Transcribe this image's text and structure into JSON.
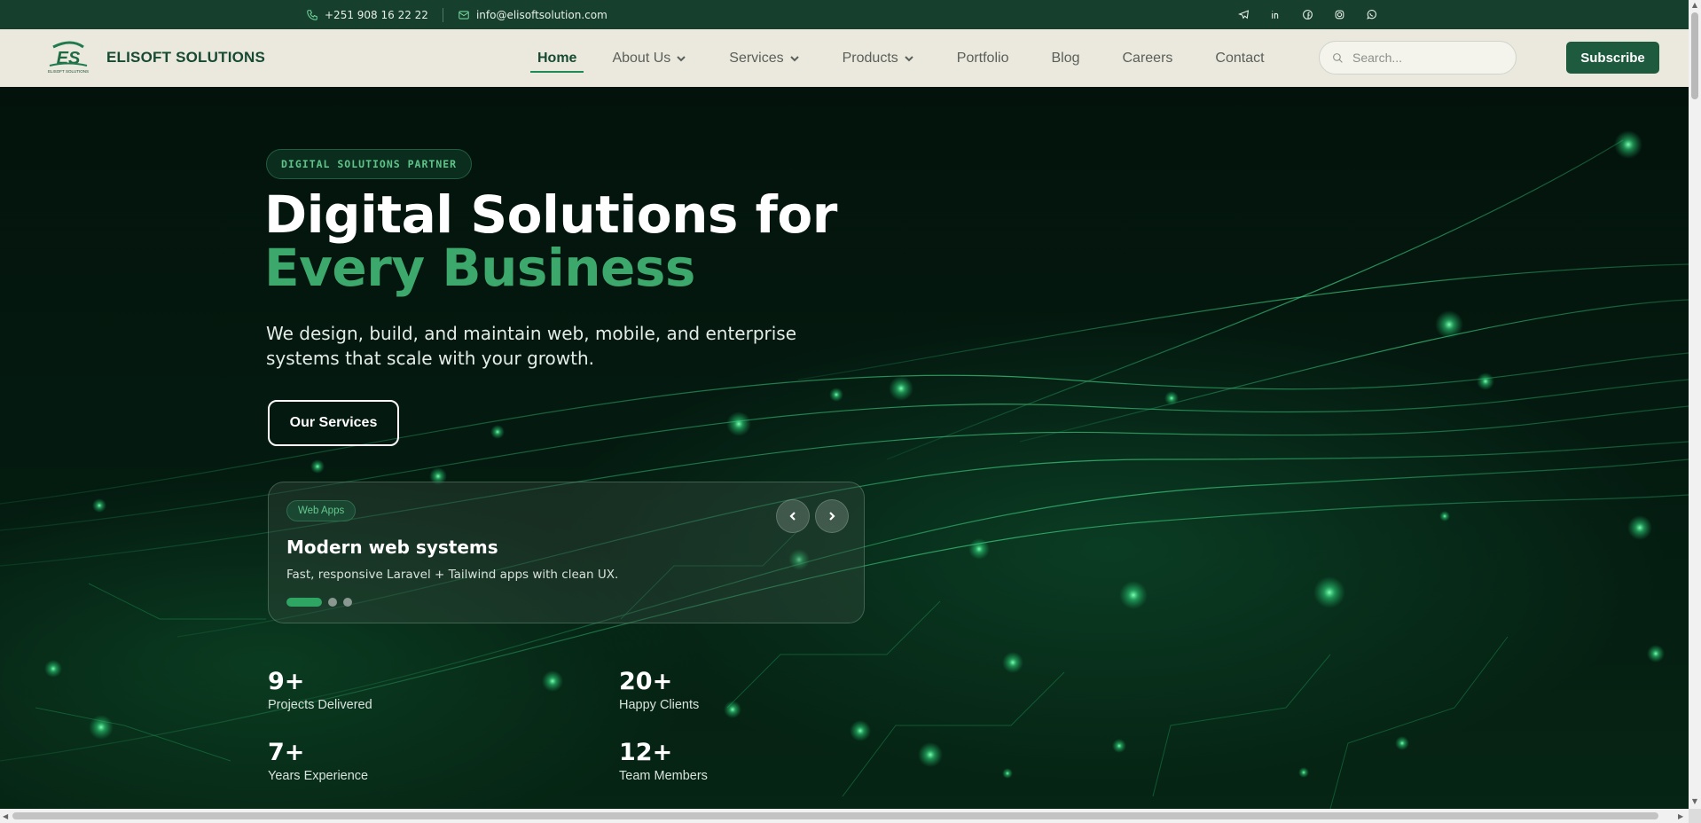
{
  "topbar": {
    "phone": "+251 908 16 22 22",
    "email": "info@elisoftsolution.com",
    "social": [
      "telegram-icon",
      "linkedin-icon",
      "facebook-icon",
      "instagram-icon",
      "whatsapp-icon"
    ]
  },
  "brand": {
    "name": "ELISOFT SOLUTIONS",
    "logo_caption": "ELISOFT SOLUTIONS",
    "primary_color": "#174a33",
    "accent_color": "#3da86b"
  },
  "nav": {
    "items": [
      {
        "label": "Home",
        "active": true
      },
      {
        "label": "About Us",
        "dropdown": true
      },
      {
        "label": "Services",
        "dropdown": true
      },
      {
        "label": "Products",
        "dropdown": true
      },
      {
        "label": "Portfolio"
      },
      {
        "label": "Blog"
      },
      {
        "label": "Careers"
      },
      {
        "label": "Contact"
      }
    ],
    "search_placeholder": "Search...",
    "subscribe_label": "Subscribe"
  },
  "hero": {
    "badge": "DIGITAL SOLUTIONS PARTNER",
    "title_line1": "Digital Solutions for",
    "title_line2": "Every Business",
    "lead": "We design, build, and maintain web, mobile, and enterprise systems that scale with your growth.",
    "cta_label": "Our Services"
  },
  "slider": {
    "tag": "Web Apps",
    "title": "Modern web systems",
    "description": "Fast, responsive Laravel + Tailwind apps with clean UX.",
    "slide_count": 3,
    "active_slide": 1
  },
  "stats": [
    {
      "value": "9+",
      "label": "Projects Delivered"
    },
    {
      "value": "20+",
      "label": "Happy Clients"
    },
    {
      "value": "7+",
      "label": "Years Experience"
    },
    {
      "value": "12+",
      "label": "Team Members"
    }
  ]
}
